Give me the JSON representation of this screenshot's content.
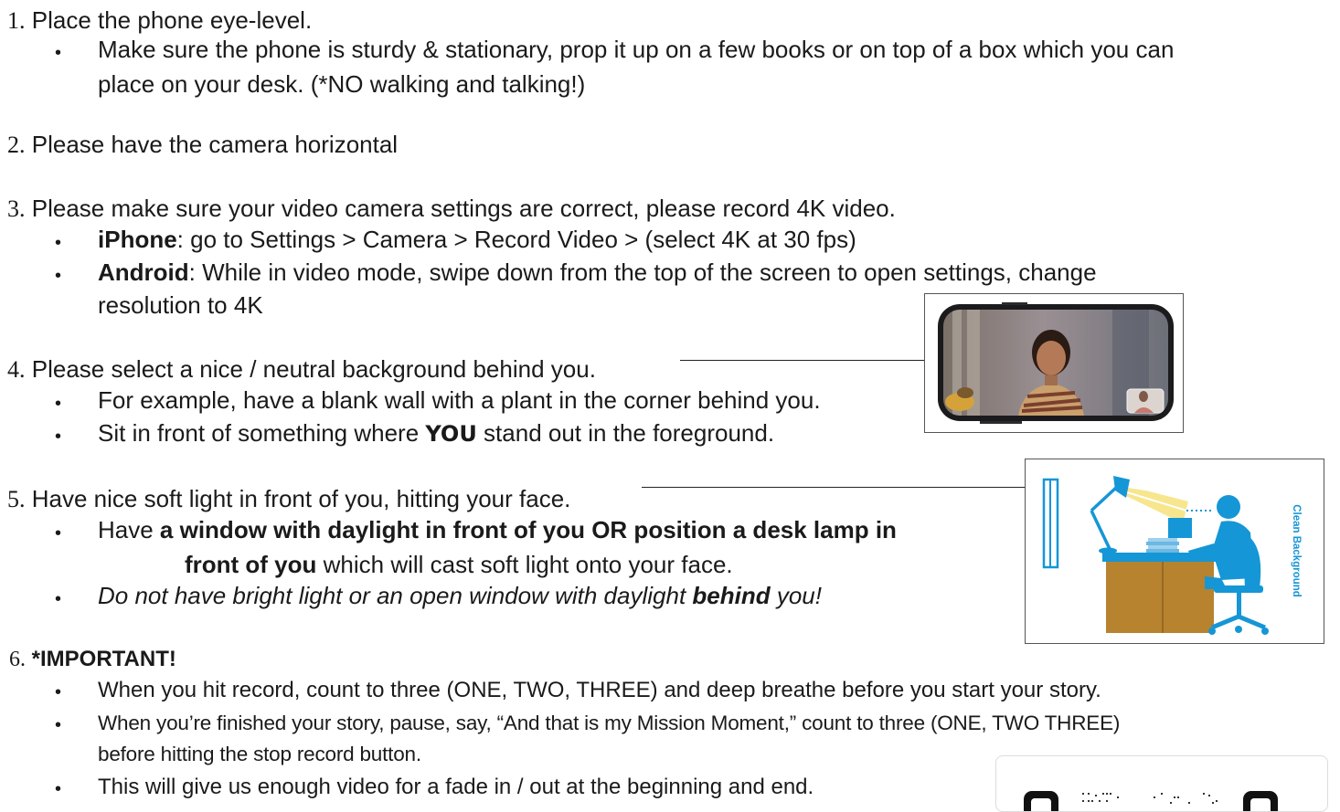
{
  "steps": [
    {
      "num": "1.",
      "text": "Place the phone eye-level."
    },
    {
      "num": "2.",
      "text": "Please have the camera horizontal"
    },
    {
      "num": "3.",
      "text": "Please make sure your video camera settings are correct, please record 4K video."
    },
    {
      "num": "4.",
      "text": "Please select a nice / neutral background behind you."
    },
    {
      "num": "5.",
      "text": "Have nice soft light in front of you, hitting your face."
    },
    {
      "num": "6.",
      "text": "*IMPORTANT!"
    }
  ],
  "bullets": {
    "b1_line1": "Make sure the phone is sturdy & stationary, prop it up on a few books or on top of a box which you can",
    "b1_line2": "place on your desk. (*NO walking and talking!)",
    "iphone_label": "iPhone",
    "iphone_text": ": go to Settings > Camera > Record Video > (select 4K at 30 fps)",
    "android_label": "Android",
    "android_line1": ": While in video mode, swipe down from the top of the screen to open settings, change",
    "android_line2": "resolution to 4K",
    "bg_example": "For example, have a blank wall with a plant in the corner behind you.",
    "sit_pre": "Sit in front of something where ",
    "sit_you": "YOU",
    "sit_post": " stand out in the foreground.",
    "light_pre": "Have ",
    "light_bold1": "a window with daylight in front of you OR position a desk lamp in",
    "light_bold2": "front of you",
    "light_post": " which will cast soft light onto your face.",
    "no_light_pre": "Do not have bright light or an open window with daylight ",
    "no_light_bold": "behind",
    "no_light_post": " you!",
    "imp1": "When you hit record, count to three (ONE, TWO, THREE) and deep breathe before you start your story.",
    "imp2_line1": "When you’re finished your story, pause, say, “And that is my Mission Moment,” count to three (ONE, TWO THREE)",
    "imp2_line2": "before hitting the stop record button.",
    "imp3": "This will give us enough video for a fade in / out at the beginning and end."
  },
  "figure_desk": {
    "side_label": "Clean Background"
  },
  "colors": {
    "blue": "#1596d6",
    "desk": "#b7832e",
    "lamp_light": "#f6e27a"
  }
}
